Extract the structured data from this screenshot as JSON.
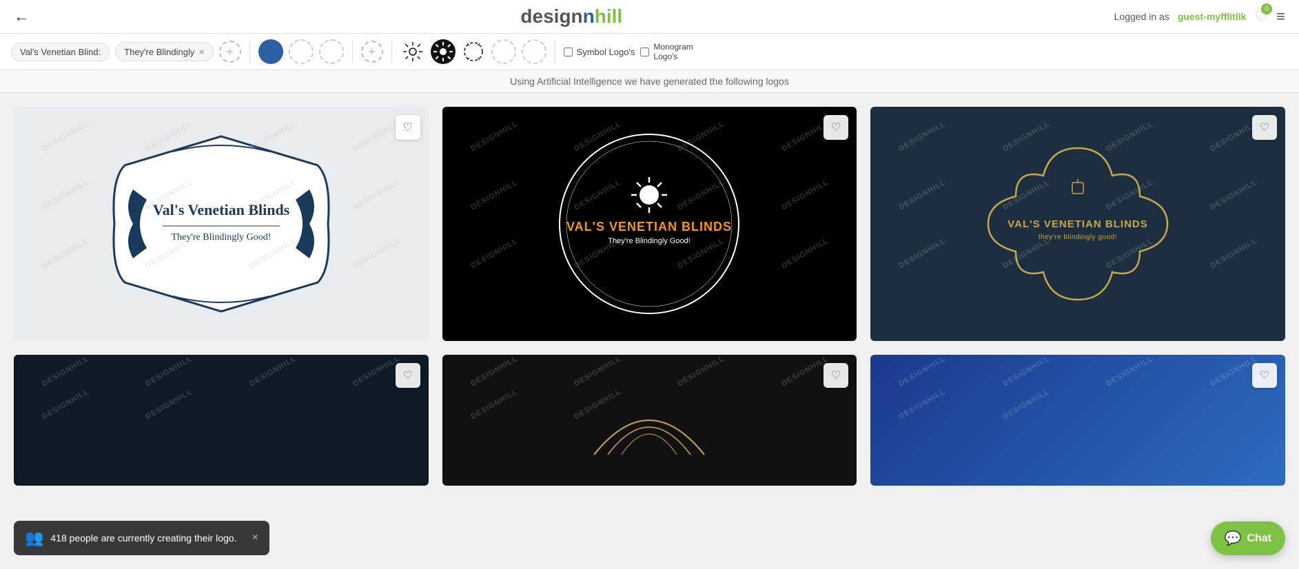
{
  "header": {
    "back_label": "←",
    "logo_design": "design",
    "logo_hill": "hill",
    "logged_in_prefix": "Logged in as",
    "username": "guest-myfflitllk",
    "heart_count": "0",
    "menu_icon": "≡"
  },
  "toolbar": {
    "tab1_label": "Val's Venetian Blind:",
    "tab2_label": "They're Blindingly",
    "tab2_remove": "×",
    "add_btn1": "+",
    "add_btn2": "+",
    "colors": [
      {
        "hex": "#2c5fa3",
        "empty": false
      },
      {
        "hex": "#ffffff",
        "empty": true
      },
      {
        "hex": "#ffffff",
        "empty": true
      }
    ],
    "patterns": [
      "sun",
      "sun-bold",
      "circle-dashed"
    ],
    "swatches_extra": [
      "empty1",
      "empty2"
    ],
    "checkbox1_label": "Symbol Logo's",
    "checkbox2_label": "Monogram Logo's"
  },
  "ai_text": "Using Artificial Intelligence we have generated the following logos",
  "logos": [
    {
      "id": 1,
      "bg": "white",
      "company": "Val's Venetian Blinds",
      "tagline": "They're Blindingly Good!",
      "style": "frame"
    },
    {
      "id": 2,
      "bg": "black",
      "company": "VAL'S VENETIAN BLINDS",
      "tagline": "They're Blindingly Good!",
      "style": "circle"
    },
    {
      "id": 3,
      "bg": "darkblue",
      "company": "VAL'S VENETIAN BLINDS",
      "tagline": "they're blindingly good!",
      "style": "clover"
    },
    {
      "id": 4,
      "bg": "darknavy",
      "company": "",
      "tagline": "",
      "style": "bottom1"
    },
    {
      "id": 5,
      "bg": "darkest",
      "company": "",
      "tagline": "",
      "style": "bottom2"
    },
    {
      "id": 6,
      "bg": "blue-gradient",
      "company": "",
      "tagline": "",
      "style": "bottom3"
    }
  ],
  "notification": {
    "icon": "👥",
    "text": "418 people are currently creating their logo.",
    "close": "×"
  },
  "chat": {
    "label": "Chat",
    "icon": "💬"
  },
  "watermark": "DESIGNHILL"
}
